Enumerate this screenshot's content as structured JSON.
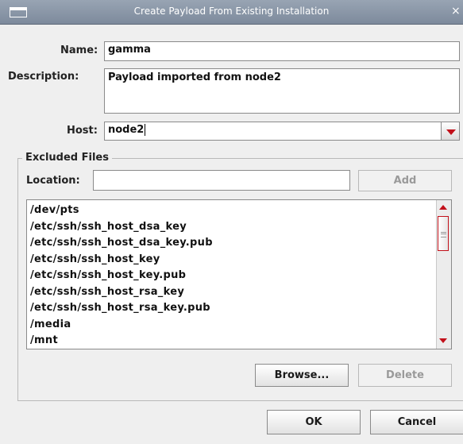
{
  "window": {
    "title": "Create Payload From Existing Installation",
    "close_glyph": "×",
    "icon": "window-menu-icon"
  },
  "form": {
    "name_label": "Name:",
    "name_value": "gamma",
    "description_label": "Description:",
    "description_value": "Payload imported from node2",
    "host_label": "Host:",
    "host_value": "node2"
  },
  "excluded_files": {
    "title": "Excluded Files",
    "location_label": "Location:",
    "location_value": "",
    "add_label": "Add",
    "files": [
      "/dev/pts",
      "/etc/ssh/ssh_host_dsa_key",
      "/etc/ssh/ssh_host_dsa_key.pub",
      "/etc/ssh/ssh_host_key",
      "/etc/ssh/ssh_host_key.pub",
      "/etc/ssh/ssh_host_rsa_key",
      "/etc/ssh/ssh_host_rsa_key.pub",
      "/media",
      "/mnt"
    ],
    "browse_label": "Browse...",
    "delete_label": "Delete"
  },
  "buttons": {
    "ok_label": "OK",
    "cancel_label": "Cancel"
  },
  "colors": {
    "titlebar": "#8c98a9",
    "accent_red": "#c2101a",
    "background": "#efefef"
  }
}
